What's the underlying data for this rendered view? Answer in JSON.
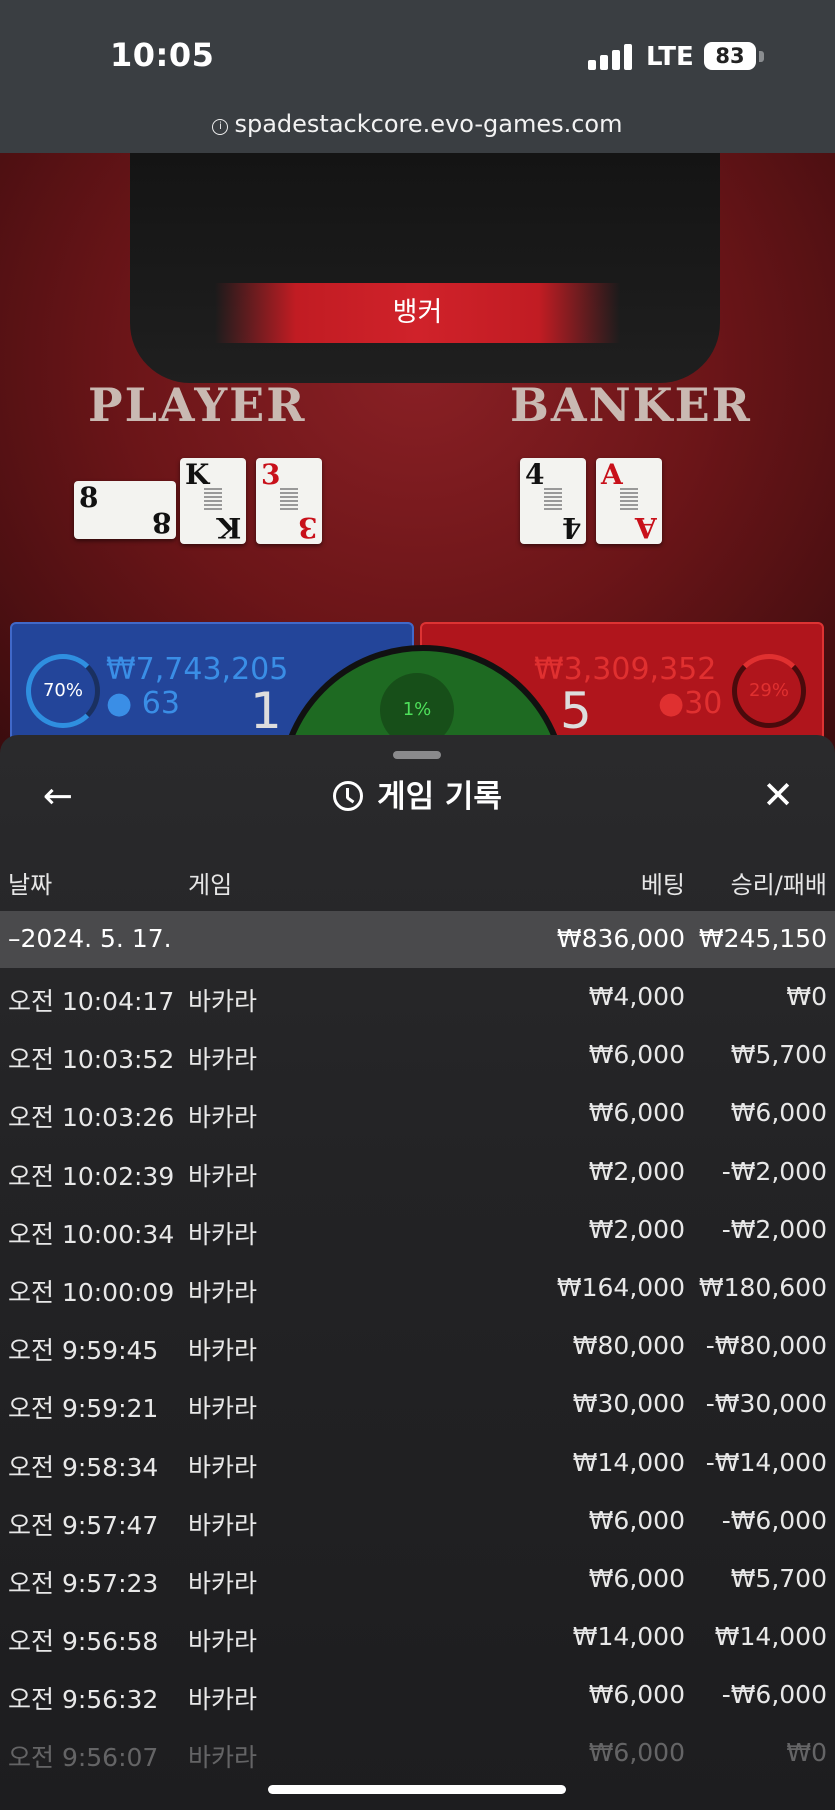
{
  "status_bar": {
    "time": "10:05",
    "network": "LTE",
    "battery": "83"
  },
  "browser": {
    "url": "spadestackcore.evo-games.com"
  },
  "game": {
    "banner": "뱅커",
    "player_label": "PLAYER",
    "banker_label": "BANKER",
    "player_cards": [
      {
        "rank": "8",
        "suit": "♠",
        "red": false
      },
      {
        "rank": "K",
        "suit": "♠",
        "red": false
      },
      {
        "rank": "3",
        "suit": "♦",
        "red": true
      }
    ],
    "banker_cards": [
      {
        "rank": "4",
        "suit": "♠",
        "red": false
      },
      {
        "rank": "A",
        "suit": "♥",
        "red": true
      }
    ],
    "player_bet": {
      "percent": "70%",
      "amount": "₩7,743,205",
      "count": "63",
      "score": "1"
    },
    "banker_bet": {
      "percent": "29%",
      "amount": "₩3,309,352",
      "count": "30",
      "score": "5"
    },
    "tie": {
      "percent": "1%"
    }
  },
  "history": {
    "title": "게임 기록",
    "columns": {
      "date": "날짜",
      "game": "게임",
      "bet": "베팅",
      "result": "승리/패배"
    },
    "summary": {
      "date": "–2024. 5. 17.",
      "bet": "₩836,000",
      "result": "₩245,150"
    },
    "rows": [
      {
        "time": "오전 10:04:17",
        "game": "바카라",
        "bet": "₩4,000",
        "result": "₩0"
      },
      {
        "time": "오전 10:03:52",
        "game": "바카라",
        "bet": "₩6,000",
        "result": "₩5,700"
      },
      {
        "time": "오전 10:03:26",
        "game": "바카라",
        "bet": "₩6,000",
        "result": "₩6,000"
      },
      {
        "time": "오전 10:02:39",
        "game": "바카라",
        "bet": "₩2,000",
        "result": "-₩2,000"
      },
      {
        "time": "오전 10:00:34",
        "game": "바카라",
        "bet": "₩2,000",
        "result": "-₩2,000"
      },
      {
        "time": "오전 10:00:09",
        "game": "바카라",
        "bet": "₩164,000",
        "result": "₩180,600"
      },
      {
        "time": "오전 9:59:45",
        "game": "바카라",
        "bet": "₩80,000",
        "result": "-₩80,000"
      },
      {
        "time": "오전 9:59:21",
        "game": "바카라",
        "bet": "₩30,000",
        "result": "-₩30,000"
      },
      {
        "time": "오전 9:58:34",
        "game": "바카라",
        "bet": "₩14,000",
        "result": "-₩14,000"
      },
      {
        "time": "오전 9:57:47",
        "game": "바카라",
        "bet": "₩6,000",
        "result": "-₩6,000"
      },
      {
        "time": "오전 9:57:23",
        "game": "바카라",
        "bet": "₩6,000",
        "result": "₩5,700"
      },
      {
        "time": "오전 9:56:58",
        "game": "바카라",
        "bet": "₩14,000",
        "result": "₩14,000"
      },
      {
        "time": "오전 9:56:32",
        "game": "바카라",
        "bet": "₩6,000",
        "result": "-₩6,000"
      },
      {
        "time": "오전 9:56:07",
        "game": "바카라",
        "bet": "₩6,000",
        "result": "₩0"
      }
    ]
  },
  "colors": {
    "player_blue": "#23459a",
    "banker_red": "#b0151c",
    "tie_green": "#1e6a22",
    "panel_bg": "#232325"
  }
}
